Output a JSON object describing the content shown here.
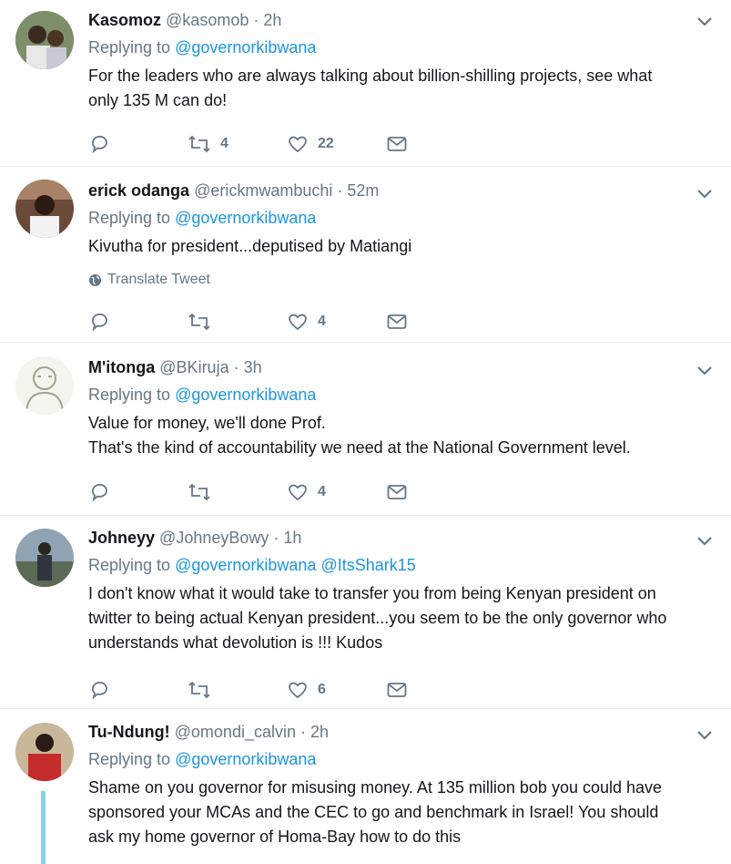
{
  "tweets": [
    {
      "name": "Kasomoz",
      "handle": "@kasomob",
      "separator": "·",
      "time": "2h",
      "replying_prefix": "Replying to",
      "mentions": [
        "@governorkibwana"
      ],
      "lines": [
        "For the leaders who are always talking about billion-shilling projects,  see what",
        "only 135 M can do!"
      ],
      "retweets": "4",
      "likes": "22",
      "avatar_icon": "profile-photo"
    },
    {
      "name": "erick odanga",
      "handle": "@erickmwambuchi",
      "separator": "·",
      "time": "52m",
      "replying_prefix": "Replying to",
      "mentions": [
        "@governorkibwana"
      ],
      "lines": [
        "Kivutha for president...deputised by Matiangi"
      ],
      "translate": "Translate Tweet",
      "retweets": "",
      "likes": "4",
      "avatar_icon": "profile-photo"
    },
    {
      "name": "M'itonga",
      "handle": "@BKiruja",
      "separator": "·",
      "time": "3h",
      "replying_prefix": "Replying to",
      "mentions": [
        "@governorkibwana"
      ],
      "lines": [
        "Value for money, we'll done Prof.",
        "That's the kind of accountability we need at the National Government level."
      ],
      "retweets": "",
      "likes": "4",
      "avatar_icon": "profile-sketch"
    },
    {
      "name": "Johneyy",
      "handle": "@JohneyBowy",
      "separator": "·",
      "time": "1h",
      "replying_prefix": "Replying to",
      "mentions": [
        "@governorkibwana",
        "@ItsShark15"
      ],
      "lines": [
        "I don't know what it would take to transfer you from being Kenyan president on",
        "twitter to being actual Kenyan president...you seem to be the only governor who",
        "understands what devolution is !!! Kudos"
      ],
      "retweets": "",
      "likes": "6",
      "avatar_icon": "profile-photo"
    },
    {
      "name": "Tu-Ndung!",
      "handle": "@omondi_calvin",
      "separator": "·",
      "time": "2h",
      "replying_prefix": "Replying to",
      "mentions": [
        "@governorkibwana"
      ],
      "lines": [
        "Shame on you governor for misusing money. At 135 million bob you could have",
        "sponsored  your MCAs and the CEC to go and benchmark in Israel! You should",
        "ask my home governor of Homa-Bay how to do this"
      ],
      "avatar_icon": "profile-photo"
    }
  ],
  "colors": {
    "link": "#1b95e0",
    "secondary": "#657786",
    "divider": "#e6ecf0",
    "thread": "#85d2e6"
  }
}
